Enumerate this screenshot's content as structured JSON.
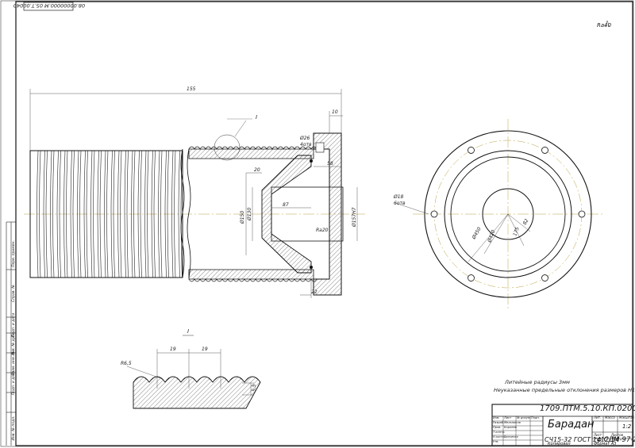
{
  "sheet": {
    "top_code": "08.00000000.М 05.Т.00040",
    "roughness": "Ra40",
    "format_label": "Формат   А3",
    "copied_label": "Копировал"
  },
  "drawing": {
    "dims": {
      "overall_length": "155",
      "flange_thickness": "10",
      "bolt_hole": "Ø26",
      "bolt_count": "4отв",
      "d58": "58",
      "d20": "20",
      "d150": "Ø150",
      "d130": "Ø130",
      "d87": "87",
      "d157": "Ø157H7",
      "roughness_inner": "Ra20",
      "d22": "22",
      "detail_marker": "I",
      "hole_count_view": "Ø18",
      "hole_count_label": "6отв",
      "r50": "Ø450",
      "r420": "Ø420",
      "r175": "175",
      "r82": "82"
    },
    "detail": {
      "title": "I",
      "pitch_a": "19",
      "pitch_b": "19",
      "radius": "R6,5",
      "depth": "5,5"
    }
  },
  "notes": {
    "line1": "Литейные радиусы 3мм",
    "line2": "Неуказанные предельные отклонения размеров Н14, h14, ±t/2"
  },
  "title_block": {
    "doc_number": "1709.ПТМ.5.10.КП.0200000.В0",
    "part_name": "Барадан",
    "material": "СЧ15-32 ГОСТ 1412-54",
    "group": "гр.СДМ-97-2",
    "scale": "1:2",
    "sheet_label": "Лист",
    "sheets_label": "Листов",
    "col_lit": "Лит.",
    "col_mass": "Масса",
    "col_scale": "Масштаб",
    "rows": [
      {
        "role": "Изм.",
        "name": "Лист",
        "sign": "№ докум.",
        "date": "Подп."
      },
      {
        "role": "Разраб.",
        "name": "Мельников",
        "sign": "",
        "date": ""
      },
      {
        "role": "Пров.",
        "name": "Корнеев",
        "sign": "",
        "date": ""
      },
      {
        "role": "Т.контр.",
        "name": "",
        "sign": "",
        "date": ""
      },
      {
        "role": "Н.контр.",
        "name": "Заиченко",
        "sign": "",
        "date": ""
      },
      {
        "role": "Утв.",
        "name": "",
        "sign": "",
        "date": ""
      }
    ]
  },
  "side_strip": {
    "cells": [
      "Перв. примен.",
      "Справ. №",
      "Подп. и дата",
      "Инв. № дубл.",
      "Взам. инв. №",
      "Подп. и дата",
      "Инв. № подл."
    ]
  }
}
